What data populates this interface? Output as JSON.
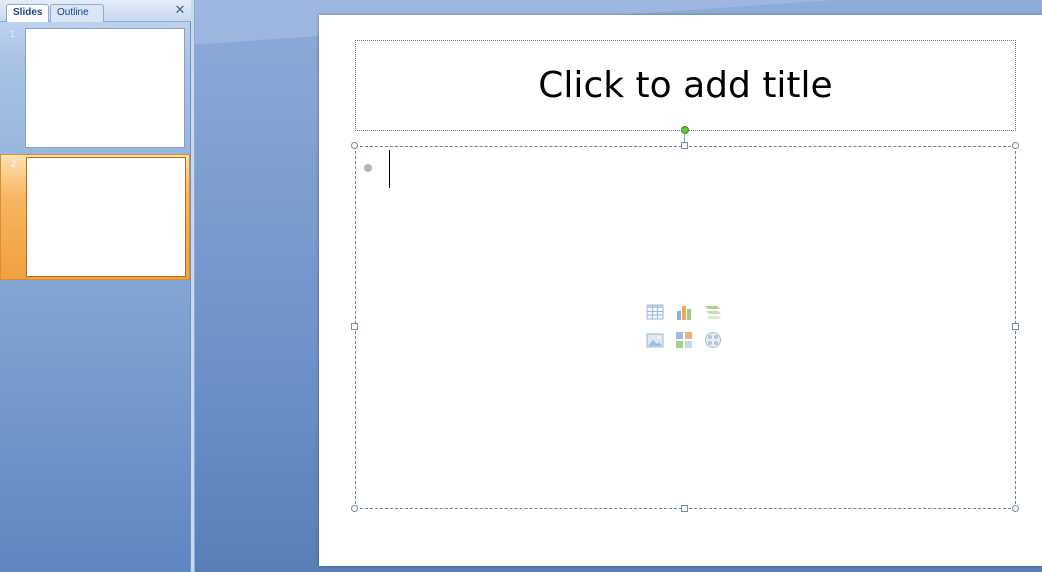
{
  "pane": {
    "tab_slides": "Slides",
    "tab_outline": "Outline",
    "close_glyph": "✕",
    "thumbnails": [
      {
        "number": "1",
        "selected": false
      },
      {
        "number": "2",
        "selected": true
      }
    ]
  },
  "slide": {
    "title_placeholder": "Click to add title",
    "content_insert_icons": [
      "insert-table-icon",
      "insert-chart-icon",
      "insert-smartart-icon",
      "insert-picture-icon",
      "insert-clipart-icon",
      "insert-media-icon"
    ]
  },
  "colors": {
    "selected_thumb": "#f7b561",
    "workspace": "#7d9dcf",
    "rotate_handle": "#6fbf3a"
  }
}
